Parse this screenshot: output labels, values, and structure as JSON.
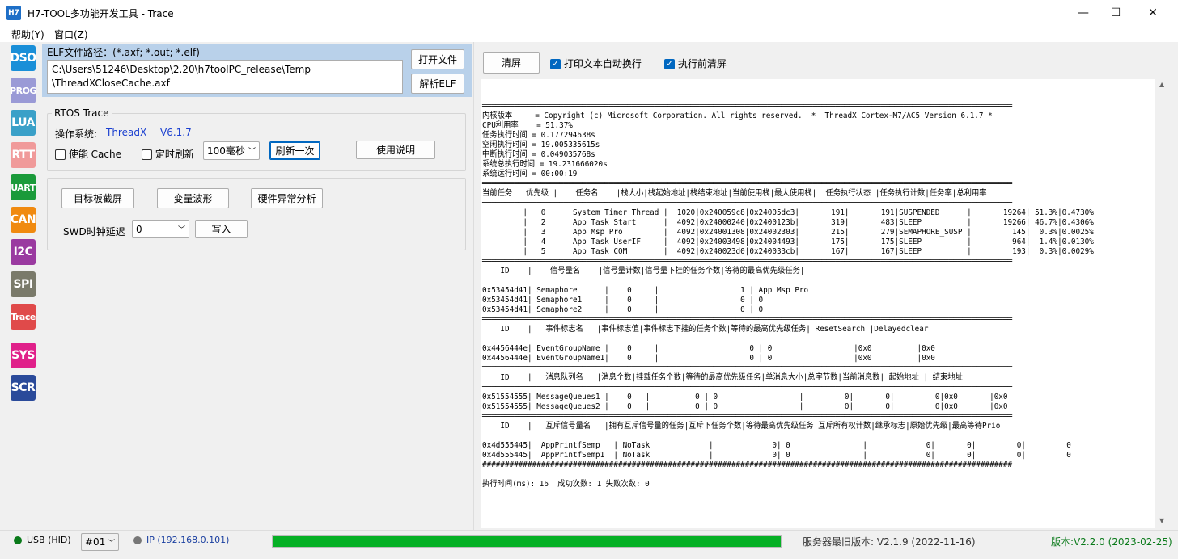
{
  "window": {
    "title": "H7-TOOL多功能开发工具 - Trace",
    "icon_label": "H7",
    "minimize": "—",
    "maximize": "☐",
    "close": "✕"
  },
  "menu": [
    "帮助(Y)",
    "窗口(Z)"
  ],
  "sidebar": [
    {
      "label": "DSO",
      "color": "#1a8fd8"
    },
    {
      "label": "PROG",
      "color": "#9a9ad6"
    },
    {
      "label": "LUA",
      "color": "#3aa0c8"
    },
    {
      "label": "RTT",
      "color": "#f09a9a"
    },
    {
      "label": "UART",
      "color": "#1a9a3a"
    },
    {
      "label": "CAN",
      "color": "#f08a10"
    },
    {
      "label": "I2C",
      "color": "#9a3aa0"
    },
    {
      "label": "SPI",
      "color": "#7a7a6a"
    },
    {
      "label": "Trace",
      "color": "#e04a4a"
    },
    {
      "label": "SYS",
      "color": "#e0208a"
    },
    {
      "label": "SCR",
      "color": "#2a4a9a"
    }
  ],
  "elf": {
    "label": "ELF文件路径：(*.axf; *.out; *.elf)",
    "path_line1": "C:\\Users\\51246\\Desktop\\2.20\\h7toolPC_release\\Temp",
    "path_line2": "\\ThreadXCloseCache.axf",
    "open_button": "打开文件",
    "parse_button": "解析ELF"
  },
  "rtos": {
    "group_title": "RTOS Trace",
    "os_label": "操作系统:",
    "os_value": "ThreadX",
    "os_version": "V6.1.7",
    "cache_label": "使能 Cache",
    "timer_label": "定时刷新",
    "interval": "100毫秒",
    "refresh_button": "刷新一次",
    "help_button": "使用说明"
  },
  "tools": {
    "screenshot_button": "目标板截屏",
    "waveform_button": "变量波形",
    "fault_button": "硬件异常分析",
    "swd_label": "SWD时钟延迟",
    "swd_value": "0",
    "write_button": "写入"
  },
  "right": {
    "clear_button": "清屏",
    "autowrap_label": "打印文本自动换行",
    "clear_before_label": "执行前清屏",
    "output": "═════════════════════════════════════════════════════════════════════════════════════════════════════════════════════\n内核版本     = Copyright (c) Microsoft Corporation. All rights reserved.  *  ThreadX Cortex-M7/AC5 Version 6.1.7 *\nCPU利用率    = 51.37%\n任务执行时间 = 0.177294638s\n空闲执行时间 = 19.005335615s\n中断执行时间 = 0.049035768s\n系统总执行时间 = 19.231666020s\n系统运行时间 = 00:00:19\n═════════════════════════════════════════════════════════════════════════════════════════════════════════════════════\n当前任务 | 优先级 |    任务名    |栈大小|栈起始地址|栈结束地址|当前使用栈|最大使用栈|  任务执行状态 |任务执行计数|任务率|总利用率\n─────────────────────────────────────────────────────────────────────────────────────────────────────────────────────\n         |   0    | System Timer Thread |  1020|0x240059c8|0x24005dc3|       191|       191|SUSPENDED      |       19264| 51.3%|0.4730%\n         |   2    | App Task Start      |  4092|0x24000240|0x2400123b|       319|       483|SLEEP          |       19266| 46.7%|0.4306%\n         |   3    | App Msp Pro         |  4092|0x24001308|0x24002303|       215|       279|SEMAPHORE_SUSP |         145|  0.3%|0.0025%\n         |   4    | App Task UserIF     |  4092|0x24003498|0x24004493|       175|       175|SLEEP          |         964|  1.4%|0.0130%\n         |   5    | App Task COM        |  4092|0x240023d0|0x240033cb|       167|       167|SLEEP          |         193|  0.3%|0.0029%\n═════════════════════════════════════════════════════════════════════════════════════════════════════════════════════\n    ID    |    信号量名    |信号量计数|信号量下挂的任务个数|等待的最高优先级任务|\n─────────────────────────────────────────────────────────────────────────────────────────────────────────────────────\n0x53454d41| Semaphore      |    0     |                  1 | App Msp Pro\n0x53454d41| Semaphore1     |    0     |                  0 | 0\n0x53454d41| Semaphore2     |    0     |                  0 | 0\n═════════════════════════════════════════════════════════════════════════════════════════════════════════════════════\n    ID    |   事件标志名   |事件标志值|事件标志下挂的任务个数|等待的最高优先级任务| ResetSearch |Delayedclear\n─────────────────────────────────────────────────────────────────────────────────────────────────────────────────────\n0x4456444e| EventGroupName |    0     |                    0 | 0                  |0x0          |0x0\n0x4456444e| EventGroupName1|    0     |                    0 | 0                  |0x0          |0x0\n═════════════════════════════════════════════════════════════════════════════════════════════════════════════════════\n    ID    |   消息队列名   |消息个数|挂载任务个数|等待的最高优先级任务|单消息大小|总字节数|当前消息数| 起始地址 | 结束地址\n─────────────────────────────────────────────────────────────────────────────────────────────────────────────────────\n0x51554555| MessageQueues1 |    0   |          0 | 0                  |         0|       0|         0|0x0       |0x0\n0x51554555| MessageQueues2 |    0   |          0 | 0                  |         0|       0|         0|0x0       |0x0\n═════════════════════════════════════════════════════════════════════════════════════════════════════════════════════\n    ID    |   互斥信号量名   |拥有互斥信号量的任务|互斥下任务个数|等待最高优先级任务|互斥所有权计数|继承标志|原始优先级|最高等待Prio\n─────────────────────────────────────────────────────────────────────────────────────────────────────────────────────\n0x4d555445|  AppPrintfSemp   | NoTask             |             0| 0                |             0|       0|         0|         0\n0x4d555445|  AppPrintfSemp1  | NoTask             |             0| 0                |             0|       0|         0|         0\n#####################################################################################################################\n\n执行时间(ms): 16  成功次数: 1 失败次数: 0"
  },
  "status": {
    "usb": "USB (HID)",
    "port": "#01",
    "ip": "IP (192.168.0.101)",
    "progress": 1.0,
    "server_version": "服务器最旧版本: V2.1.9 (2022-11-16)",
    "version": "版本:V2.2.0 (2023-02-25)"
  }
}
